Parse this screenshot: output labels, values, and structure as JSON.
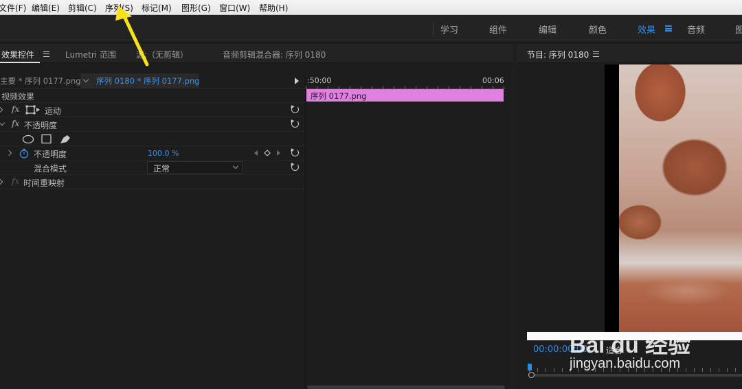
{
  "menubar": {
    "items": [
      "文件(F)",
      "编辑(E)",
      "剪辑(C)",
      "序列(S)",
      "标记(M)",
      "图形(G)",
      "窗口(W)",
      "帮助(H)"
    ]
  },
  "workspaces": {
    "items": [
      "学习",
      "组件",
      "编辑",
      "颜色",
      "效果",
      "音频",
      "图"
    ],
    "active": "效果"
  },
  "left_panel": {
    "tabs": [
      "效果控件",
      "Lumetri 范围",
      "源:（无剪辑）",
      "音频剪辑混合器: 序列 0180"
    ],
    "master_label": "主要 * 序列 0177.png",
    "sequence_label": "序列 0180 * 序列 0177.png",
    "section_header": "视频效果",
    "effects": {
      "motion": "运动",
      "opacity": "不透明度",
      "opacity_param": "不透明度",
      "opacity_value": "100.0 %",
      "blend_mode_label": "混合模式",
      "blend_mode_value": "正常",
      "time_remap": "时间重映射"
    },
    "fx_symbol": "fx"
  },
  "timeline": {
    "start_time": ":50:00",
    "end_time": "00:06",
    "clip_name": "序列 0177.png",
    "clip_color": "#e080e0"
  },
  "program_monitor": {
    "title": "节目: 序列 0180",
    "timecode": "00:00:00:00",
    "fit_label": "适合"
  },
  "watermark": {
    "line1": "Bai du 经验",
    "line2": "jingyan.baidu.com"
  },
  "colors": {
    "accent": "#2d8ceb",
    "annotation_arrow": "#f5e21a"
  }
}
